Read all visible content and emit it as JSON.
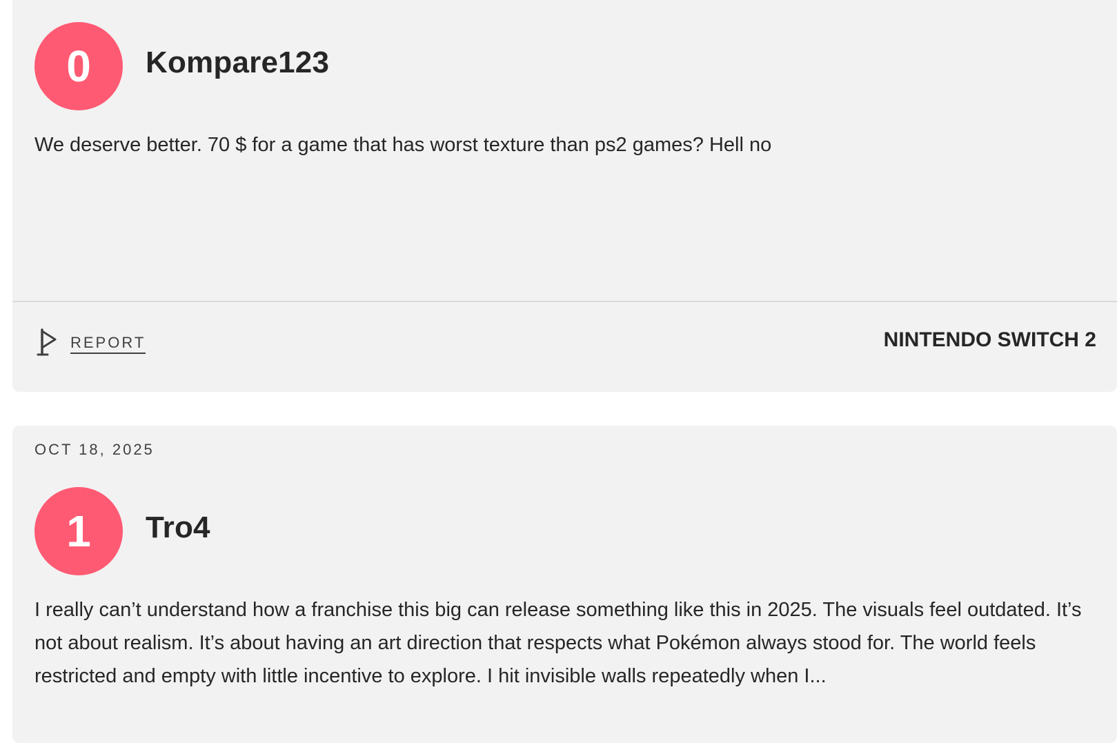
{
  "reviews": [
    {
      "score": "0",
      "score_color": "#ff5a73",
      "username": "Kompare123",
      "text": "We deserve better. 70 $ for a game that has worst texture than ps2 games? Hell no",
      "report_label": "REPORT",
      "report_icon": "flag-icon",
      "platform": "NINTENDO SWITCH 2"
    },
    {
      "date": "OCT 18, 2025",
      "score": "1",
      "score_color": "#ff5a73",
      "username": "Tro4",
      "text": "I really can’t understand how a franchise this big can release something like this in 2025. The visuals feel outdated. It’s not about realism. It’s about having an art direction that respects what Pokémon always stood for. The world feels restricted and empty with little incentive to explore. I hit invisible walls repeatedly when I..."
    }
  ]
}
